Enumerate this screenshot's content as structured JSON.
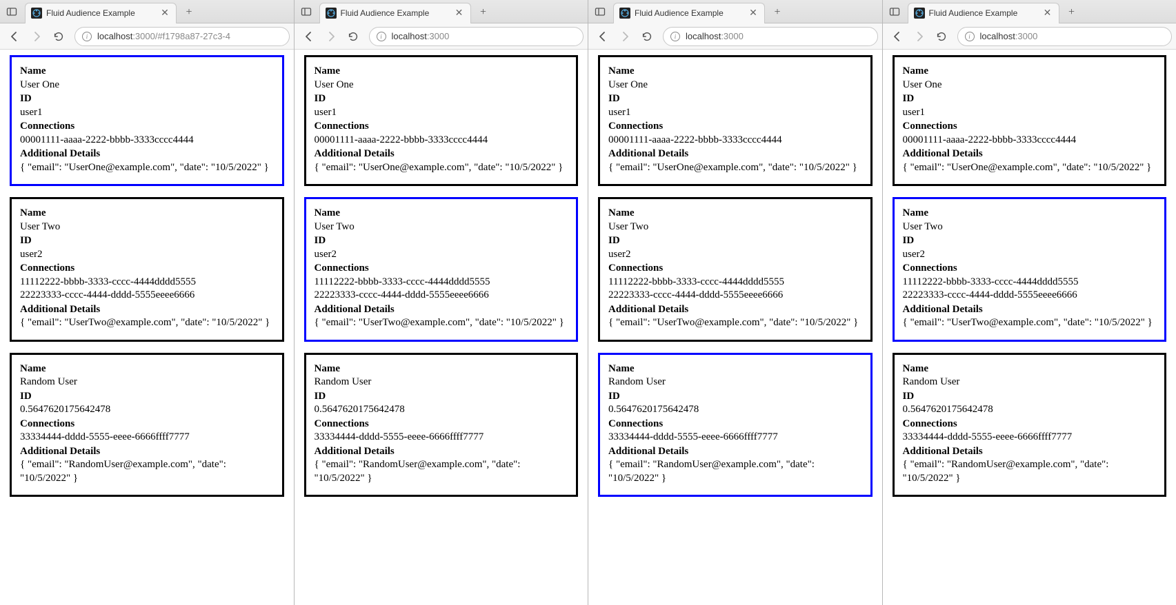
{
  "tab_title": "Fluid Audience Example",
  "urls": {
    "long": {
      "host": "localhost",
      "path": ":3000/#f1798a87-27c3-4"
    },
    "short": {
      "host": "localhost",
      "path": ":3000"
    }
  },
  "labels": {
    "name": "Name",
    "id": "ID",
    "connections": "Connections",
    "details": "Additional Details"
  },
  "users": [
    {
      "name": "User One",
      "id": "user1",
      "connections": [
        "00001111-aaaa-2222-bbbb-3333cccc4444"
      ],
      "details": "{ \"email\": \"UserOne@example.com\", \"date\": \"10/5/2022\" }"
    },
    {
      "name": "User Two",
      "id": "user2",
      "connections": [
        "11112222-bbbb-3333-cccc-4444dddd5555",
        "22223333-cccc-4444-dddd-5555eeee6666"
      ],
      "details": "{ \"email\": \"UserTwo@example.com\", \"date\": \"10/5/2022\" }"
    },
    {
      "name": "Random User",
      "id": "0.5647620175642478",
      "connections": [
        "33334444-dddd-5555-eeee-6666ffff7777"
      ],
      "details": "{ \"email\": \"RandomUser@example.com\", \"date\": \"10/5/2022\" }"
    }
  ],
  "windows": [
    {
      "url": "long",
      "active_idx": 0
    },
    {
      "url": "short",
      "active_idx": 1
    },
    {
      "url": "short",
      "active_idx": 2
    },
    {
      "url": "short",
      "active_idx": 1
    }
  ]
}
